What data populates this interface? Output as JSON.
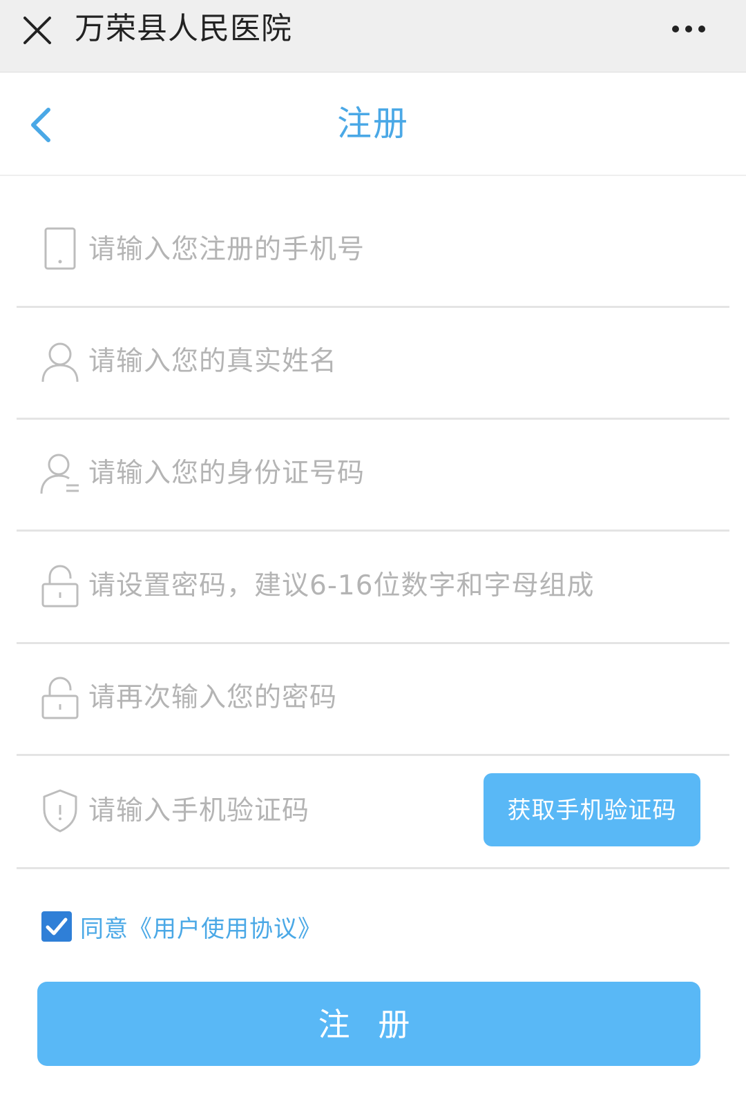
{
  "topbar": {
    "title": "万荣县人民医院",
    "close_icon": "close-icon",
    "more_icon": "more-dots-icon"
  },
  "nav": {
    "title": "注册",
    "back_icon": "chevron-left-icon"
  },
  "form": {
    "phone": {
      "placeholder": "请输入您注册的手机号",
      "icon": "phone-icon",
      "value": ""
    },
    "name": {
      "placeholder": "请输入您的真实姓名",
      "icon": "user-icon",
      "value": ""
    },
    "id_card": {
      "placeholder": "请输入您的身份证号码",
      "icon": "id-user-icon",
      "value": ""
    },
    "password": {
      "placeholder": "请设置密码，建议6-16位数字和字母组成",
      "icon": "lock-icon",
      "value": ""
    },
    "password_confirm": {
      "placeholder": "请再次输入您的密码",
      "icon": "lock-icon",
      "value": ""
    },
    "sms_code": {
      "placeholder": "请输入手机验证码",
      "icon": "shield-icon",
      "value": ""
    },
    "get_code_label": "获取手机验证码"
  },
  "agreement": {
    "checked": true,
    "label": "同意《用户使用协议》"
  },
  "submit_label": "注 册",
  "colors": {
    "accent": "#59b8f6",
    "title_blue": "#4aa8e6",
    "checkbox": "#2f7fd7",
    "placeholder": "#b4b4b4"
  }
}
